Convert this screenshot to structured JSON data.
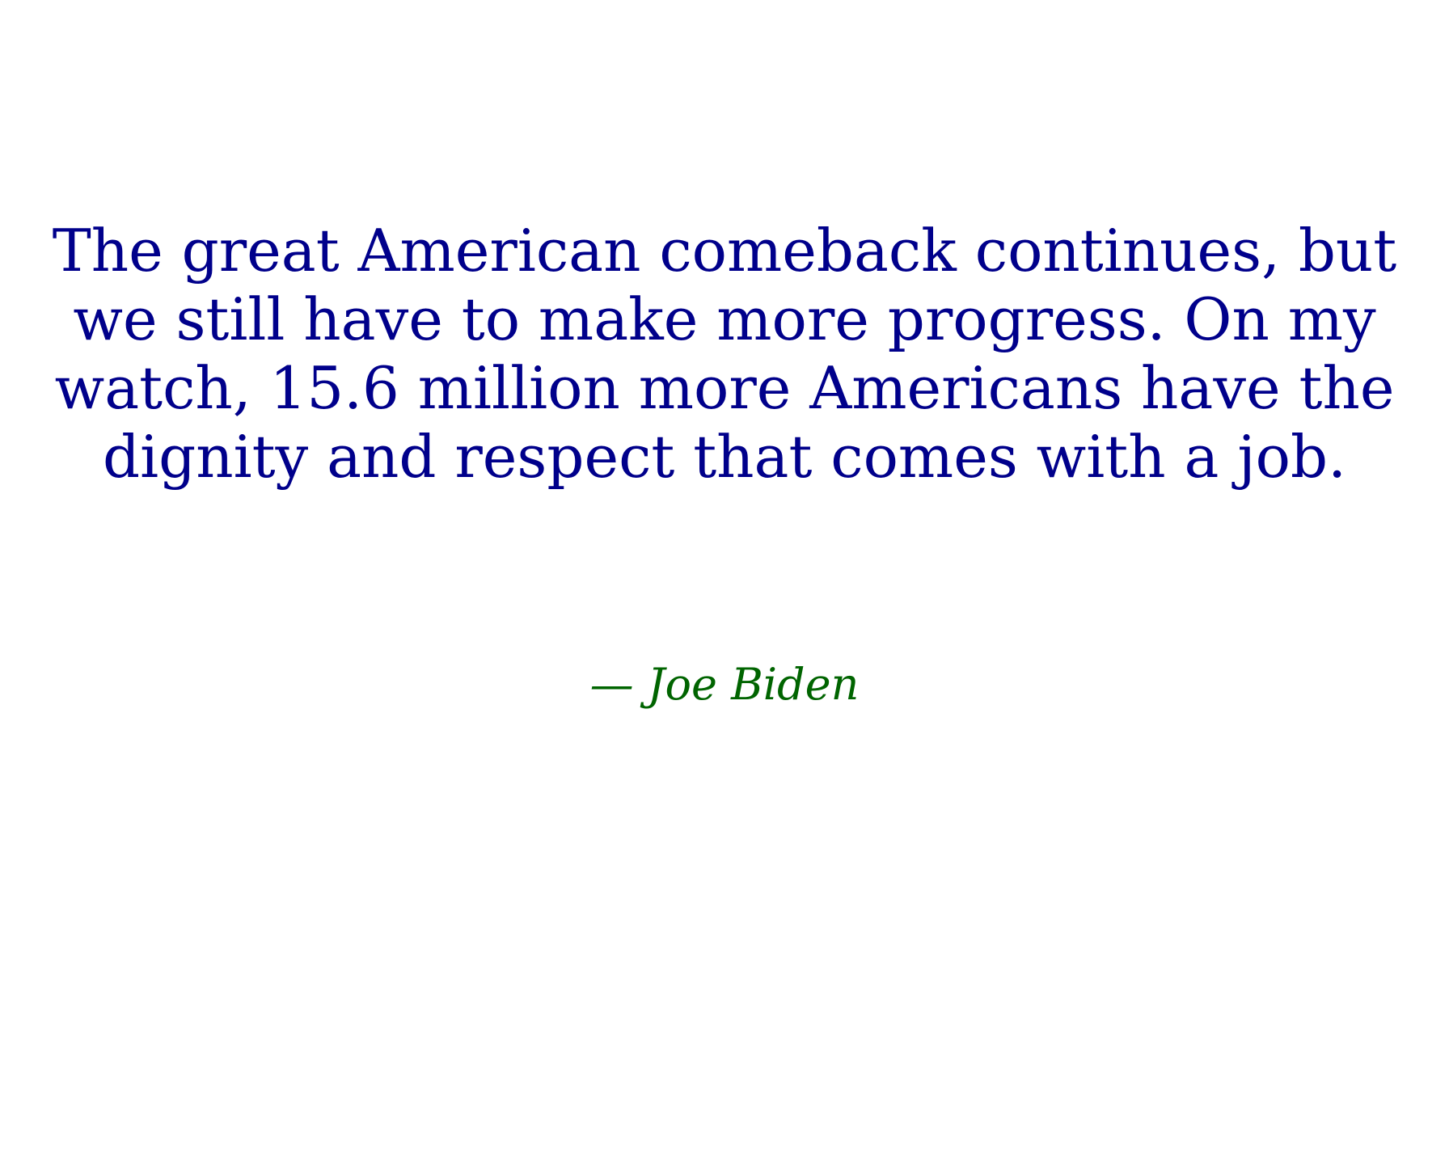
{
  "quote": {
    "lines": [
      "The great American comeback continues, but",
      "we still have to make more progress. On my",
      "watch, 15.6 million more Americans have the",
      "dignity and respect that comes with a job."
    ],
    "color": "#00008b"
  },
  "attribution": {
    "text": "— Joe Biden",
    "color": "#006400"
  },
  "background": "#ffffff"
}
